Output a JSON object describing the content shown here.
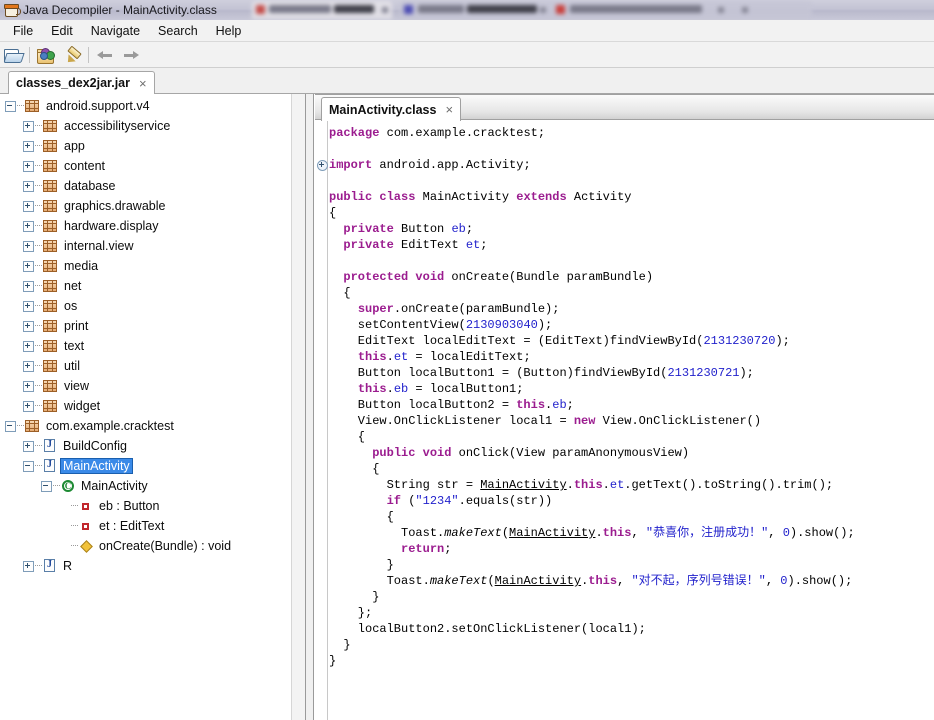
{
  "window": {
    "title": "Java Decompiler - MainActivity.class",
    "icon": "java-cup-icon"
  },
  "menubar": {
    "items": [
      {
        "label": "File",
        "name": "menu-file"
      },
      {
        "label": "Edit",
        "name": "menu-edit"
      },
      {
        "label": "Navigate",
        "name": "menu-navigate"
      },
      {
        "label": "Search",
        "name": "menu-search"
      },
      {
        "label": "Help",
        "name": "menu-help"
      }
    ]
  },
  "toolbar": {
    "buttons": [
      {
        "icon": "open-folder-icon",
        "name": "open-file-button"
      },
      {
        "icon": "open-type-icon",
        "name": "open-type-button"
      },
      {
        "icon": "pen-icon",
        "name": "edit-button"
      },
      {
        "icon": "arrow-back-icon",
        "name": "navigate-back-button"
      },
      {
        "icon": "arrow-forward-icon",
        "name": "navigate-forward-button"
      }
    ]
  },
  "jar_tabs": [
    {
      "label": "classes_dex2jar.jar",
      "close": "×",
      "active": true
    }
  ],
  "tree": {
    "nodes": [
      {
        "label": "android.support.v4",
        "indent": 0,
        "icon": "package-icon",
        "toggle": "minus",
        "selected": false
      },
      {
        "label": "accessibilityservice",
        "indent": 1,
        "icon": "package-icon",
        "toggle": "plus",
        "selected": false
      },
      {
        "label": "app",
        "indent": 1,
        "icon": "package-icon",
        "toggle": "plus",
        "selected": false
      },
      {
        "label": "content",
        "indent": 1,
        "icon": "package-icon",
        "toggle": "plus",
        "selected": false
      },
      {
        "label": "database",
        "indent": 1,
        "icon": "package-icon",
        "toggle": "plus",
        "selected": false
      },
      {
        "label": "graphics.drawable",
        "indent": 1,
        "icon": "package-icon",
        "toggle": "plus",
        "selected": false
      },
      {
        "label": "hardware.display",
        "indent": 1,
        "icon": "package-icon",
        "toggle": "plus",
        "selected": false
      },
      {
        "label": "internal.view",
        "indent": 1,
        "icon": "package-icon",
        "toggle": "plus",
        "selected": false
      },
      {
        "label": "media",
        "indent": 1,
        "icon": "package-icon",
        "toggle": "plus",
        "selected": false
      },
      {
        "label": "net",
        "indent": 1,
        "icon": "package-icon",
        "toggle": "plus",
        "selected": false
      },
      {
        "label": "os",
        "indent": 1,
        "icon": "package-icon",
        "toggle": "plus",
        "selected": false
      },
      {
        "label": "print",
        "indent": 1,
        "icon": "package-icon",
        "toggle": "plus",
        "selected": false
      },
      {
        "label": "text",
        "indent": 1,
        "icon": "package-icon",
        "toggle": "plus",
        "selected": false
      },
      {
        "label": "util",
        "indent": 1,
        "icon": "package-icon",
        "toggle": "plus",
        "selected": false
      },
      {
        "label": "view",
        "indent": 1,
        "icon": "package-icon",
        "toggle": "plus",
        "selected": false
      },
      {
        "label": "widget",
        "indent": 1,
        "icon": "package-icon",
        "toggle": "plus",
        "selected": false
      },
      {
        "label": "com.example.cracktest",
        "indent": 0,
        "icon": "package-icon",
        "toggle": "minus",
        "selected": false
      },
      {
        "label": "BuildConfig",
        "indent": 1,
        "icon": "class-file-icon",
        "toggle": "plus",
        "selected": false
      },
      {
        "label": "MainActivity",
        "indent": 1,
        "icon": "class-file-icon",
        "toggle": "minus",
        "selected": true
      },
      {
        "label": "MainActivity",
        "indent": 2,
        "icon": "class-icon",
        "toggle": "minus",
        "selected": false
      },
      {
        "label": "eb : Button",
        "indent": 3,
        "icon": "field-icon",
        "toggle": "none",
        "selected": false
      },
      {
        "label": "et : EditText",
        "indent": 3,
        "icon": "field-icon",
        "toggle": "none",
        "selected": false
      },
      {
        "label": "onCreate(Bundle) : void",
        "indent": 3,
        "icon": "method-icon",
        "toggle": "none",
        "selected": false
      },
      {
        "label": "R",
        "indent": 1,
        "icon": "class-file-icon",
        "toggle": "plus",
        "selected": false
      }
    ]
  },
  "editor": {
    "tabs": [
      {
        "label": "MainActivity.class",
        "close": "×",
        "active": true
      }
    ],
    "fold_marker_line": 2,
    "code_lines": [
      [
        {
          "t": "package",
          "c": "kw"
        },
        {
          "t": " com.example.cracktest;",
          "c": ""
        }
      ],
      [],
      [
        {
          "t": "import",
          "c": "kw"
        },
        {
          "t": " android.app.Activity;",
          "c": ""
        }
      ],
      [],
      [
        {
          "t": "public class",
          "c": "kw"
        },
        {
          "t": " MainActivity ",
          "c": ""
        },
        {
          "t": "extends",
          "c": "kw"
        },
        {
          "t": " Activity",
          "c": ""
        }
      ],
      [
        {
          "t": "{",
          "c": ""
        }
      ],
      [
        {
          "t": "  ",
          "c": ""
        },
        {
          "t": "private",
          "c": "kw"
        },
        {
          "t": " Button ",
          "c": ""
        },
        {
          "t": "eb",
          "c": "fld"
        },
        {
          "t": ";",
          "c": ""
        }
      ],
      [
        {
          "t": "  ",
          "c": ""
        },
        {
          "t": "private",
          "c": "kw"
        },
        {
          "t": " EditText ",
          "c": ""
        },
        {
          "t": "et",
          "c": "fld"
        },
        {
          "t": ";",
          "c": ""
        }
      ],
      [],
      [
        {
          "t": "  ",
          "c": ""
        },
        {
          "t": "protected void",
          "c": "kw"
        },
        {
          "t": " onCreate(Bundle paramBundle)",
          "c": ""
        }
      ],
      [
        {
          "t": "  {",
          "c": ""
        }
      ],
      [
        {
          "t": "    ",
          "c": ""
        },
        {
          "t": "super",
          "c": "kw"
        },
        {
          "t": ".onCreate(paramBundle);",
          "c": ""
        }
      ],
      [
        {
          "t": "    setContentView(",
          "c": ""
        },
        {
          "t": "2130903040",
          "c": "num"
        },
        {
          "t": ");",
          "c": ""
        }
      ],
      [
        {
          "t": "    EditText localEditText = (EditText)findViewById(",
          "c": ""
        },
        {
          "t": "2131230720",
          "c": "num"
        },
        {
          "t": ");",
          "c": ""
        }
      ],
      [
        {
          "t": "    ",
          "c": ""
        },
        {
          "t": "this",
          "c": "kw"
        },
        {
          "t": ".",
          "c": ""
        },
        {
          "t": "et",
          "c": "fld"
        },
        {
          "t": " = localEditText;",
          "c": ""
        }
      ],
      [
        {
          "t": "    Button localButton1 = (Button)findViewById(",
          "c": ""
        },
        {
          "t": "2131230721",
          "c": "num"
        },
        {
          "t": ");",
          "c": ""
        }
      ],
      [
        {
          "t": "    ",
          "c": ""
        },
        {
          "t": "this",
          "c": "kw"
        },
        {
          "t": ".",
          "c": ""
        },
        {
          "t": "eb",
          "c": "fld"
        },
        {
          "t": " = localButton1;",
          "c": ""
        }
      ],
      [
        {
          "t": "    Button localButton2 = ",
          "c": ""
        },
        {
          "t": "this",
          "c": "kw"
        },
        {
          "t": ".",
          "c": ""
        },
        {
          "t": "eb",
          "c": "fld"
        },
        {
          "t": ";",
          "c": ""
        }
      ],
      [
        {
          "t": "    View.OnClickListener local1 = ",
          "c": ""
        },
        {
          "t": "new",
          "c": "kw"
        },
        {
          "t": " View.OnClickListener()",
          "c": ""
        }
      ],
      [
        {
          "t": "    {",
          "c": ""
        }
      ],
      [
        {
          "t": "      ",
          "c": ""
        },
        {
          "t": "public void",
          "c": "kw"
        },
        {
          "t": " onClick(View paramAnonymousView)",
          "c": ""
        }
      ],
      [
        {
          "t": "      {",
          "c": ""
        }
      ],
      [
        {
          "t": "        String str = ",
          "c": ""
        },
        {
          "t": "MainActivity",
          "c": "lnk"
        },
        {
          "t": ".",
          "c": ""
        },
        {
          "t": "this",
          "c": "kw"
        },
        {
          "t": ".",
          "c": ""
        },
        {
          "t": "et",
          "c": "fld"
        },
        {
          "t": ".getText().toString().trim();",
          "c": ""
        }
      ],
      [
        {
          "t": "        ",
          "c": ""
        },
        {
          "t": "if",
          "c": "kw"
        },
        {
          "t": " (",
          "c": ""
        },
        {
          "t": "\"1234\"",
          "c": "str"
        },
        {
          "t": ".equals(str))",
          "c": ""
        }
      ],
      [
        {
          "t": "        {",
          "c": ""
        }
      ],
      [
        {
          "t": "          Toast.",
          "c": ""
        },
        {
          "t": "makeText",
          "c": "itl"
        },
        {
          "t": "(",
          "c": ""
        },
        {
          "t": "MainActivity",
          "c": "lnk"
        },
        {
          "t": ".",
          "c": ""
        },
        {
          "t": "this",
          "c": "kw"
        },
        {
          "t": ", ",
          "c": ""
        },
        {
          "t": "\"恭喜你，注册成功！\"",
          "c": "str"
        },
        {
          "t": ", ",
          "c": ""
        },
        {
          "t": "0",
          "c": "num"
        },
        {
          "t": ").show();",
          "c": ""
        }
      ],
      [
        {
          "t": "          ",
          "c": ""
        },
        {
          "t": "return",
          "c": "kw"
        },
        {
          "t": ";",
          "c": ""
        }
      ],
      [
        {
          "t": "        }",
          "c": ""
        }
      ],
      [
        {
          "t": "        Toast.",
          "c": ""
        },
        {
          "t": "makeText",
          "c": "itl"
        },
        {
          "t": "(",
          "c": ""
        },
        {
          "t": "MainActivity",
          "c": "lnk"
        },
        {
          "t": ".",
          "c": ""
        },
        {
          "t": "this",
          "c": "kw"
        },
        {
          "t": ", ",
          "c": ""
        },
        {
          "t": "\"对不起，序列号错误！\"",
          "c": "str"
        },
        {
          "t": ", ",
          "c": ""
        },
        {
          "t": "0",
          "c": "num"
        },
        {
          "t": ").show();",
          "c": ""
        }
      ],
      [
        {
          "t": "      }",
          "c": ""
        }
      ],
      [
        {
          "t": "    };",
          "c": ""
        }
      ],
      [
        {
          "t": "    localButton2.setOnClickListener(local1);",
          "c": ""
        }
      ],
      [
        {
          "t": "  }",
          "c": ""
        }
      ],
      [
        {
          "t": "}",
          "c": ""
        }
      ]
    ]
  },
  "colors": {
    "keyword": "#9b1c8f",
    "literal": "#2222cc",
    "selection": "#3a8ae8",
    "package_icon": "#e4ab73",
    "class_icon": "#1d8a33",
    "field_icon": "#c1272d",
    "method_icon": "#f2c238"
  }
}
